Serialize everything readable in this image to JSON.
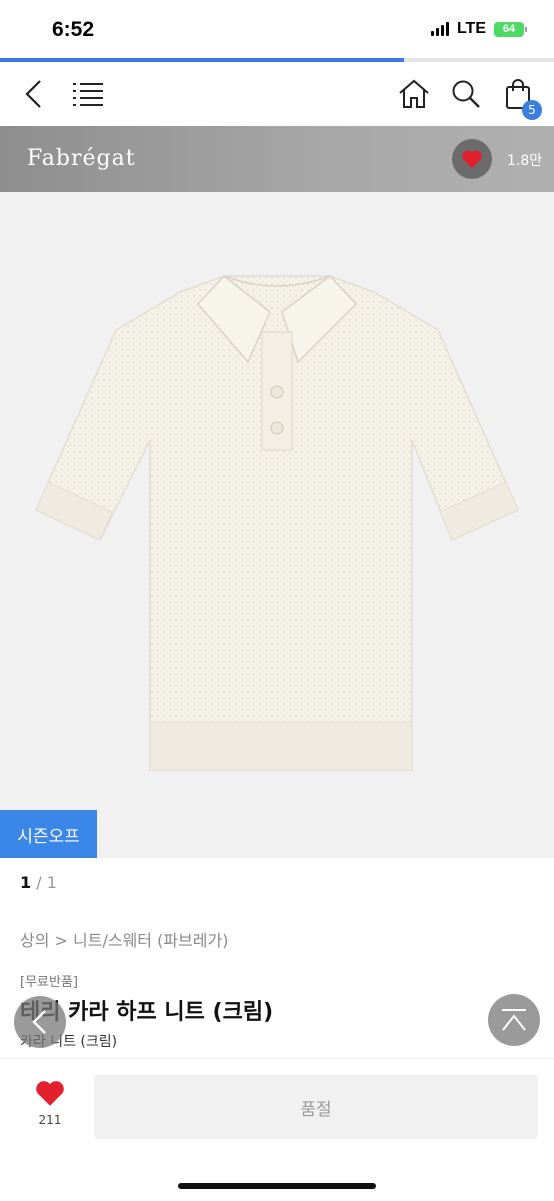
{
  "status_bar": {
    "time": "6:52",
    "network": "LTE",
    "battery": "64"
  },
  "page_progress": 0.73,
  "nav": {
    "cart_count": "5"
  },
  "brand": {
    "name": "Fabrégat",
    "like_count": "1.8만"
  },
  "product": {
    "image_alt": "Cream knit collared half-sleeve polo sweater",
    "badge": "시즌오프",
    "pager_current": "1",
    "pager_total": " / 1",
    "breadcrumb": "상의 > 니트/스웨터 (파브레가)",
    "tag": "[무료반품]",
    "title": "테리 카라 하프 니트 (크림)",
    "subtitle": "카라 니트 (크림)"
  },
  "bottom": {
    "wish_count": "211",
    "action_label": "품절"
  },
  "colors": {
    "accent": "#3b87e8",
    "heart": "#e3202e",
    "brand_bar": "#9a9a9a"
  }
}
